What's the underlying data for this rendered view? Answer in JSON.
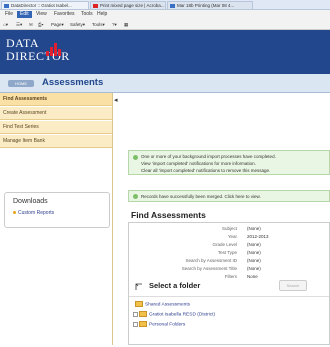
{
  "browser": {
    "tabs": [
      {
        "label": "DataDirector :: Gratiot Isabel..."
      },
      {
        "label": "Print mixed page size | Acroba..."
      },
      {
        "label": "Mar 18b Printing (Mar 08 4..."
      }
    ],
    "menu": [
      "File",
      "Edit",
      "View",
      "Favorites",
      "Tools",
      "Help"
    ],
    "toolbar": {
      "page_label": "Page",
      "safety_label": "Safety",
      "tools_label": "Tools"
    }
  },
  "app": {
    "brand_line1": "Data",
    "brand_line2": "Director",
    "nav_button_label": "HOME",
    "page_title": "Assessments",
    "brand_color": "#22478d"
  },
  "sidebar": {
    "items": [
      {
        "label": "Find Assessments"
      },
      {
        "label": "Create Assessment"
      },
      {
        "label": "Find Test Series"
      },
      {
        "label": "Manage Item Bank"
      }
    ],
    "collapse_glyph": "◂",
    "downloads": {
      "title": "Downloads",
      "link": "Custom Reports"
    }
  },
  "notices": {
    "background": {
      "line1": "One or more of your background import processes have completed.",
      "line2": "View 'import completed' notifications for more information.",
      "line3": "Clear all 'import completed' notifications to remove this message."
    },
    "merged": "Records have successfully been merged. Click here to view."
  },
  "find": {
    "title": "Find Assessments",
    "fields": [
      {
        "label": "Subject",
        "value": "(None)"
      },
      {
        "label": "Year",
        "value": "2012-2013"
      },
      {
        "label": "Grade Level",
        "value": "(None)"
      },
      {
        "label": "Test Type",
        "value": "(None)"
      },
      {
        "label": "Search by Assessment ID",
        "value": "(None)"
      },
      {
        "label": "Search by Assessment Title",
        "value": "(None)"
      },
      {
        "label": "Filters",
        "value": "None"
      }
    ],
    "select_folder": "Select a folder",
    "search_button": "Search",
    "folders": [
      {
        "label": "Shared Assessments"
      },
      {
        "label": "Gratiot Isabella RESD (District)"
      },
      {
        "label": "Personal Folders"
      }
    ]
  }
}
